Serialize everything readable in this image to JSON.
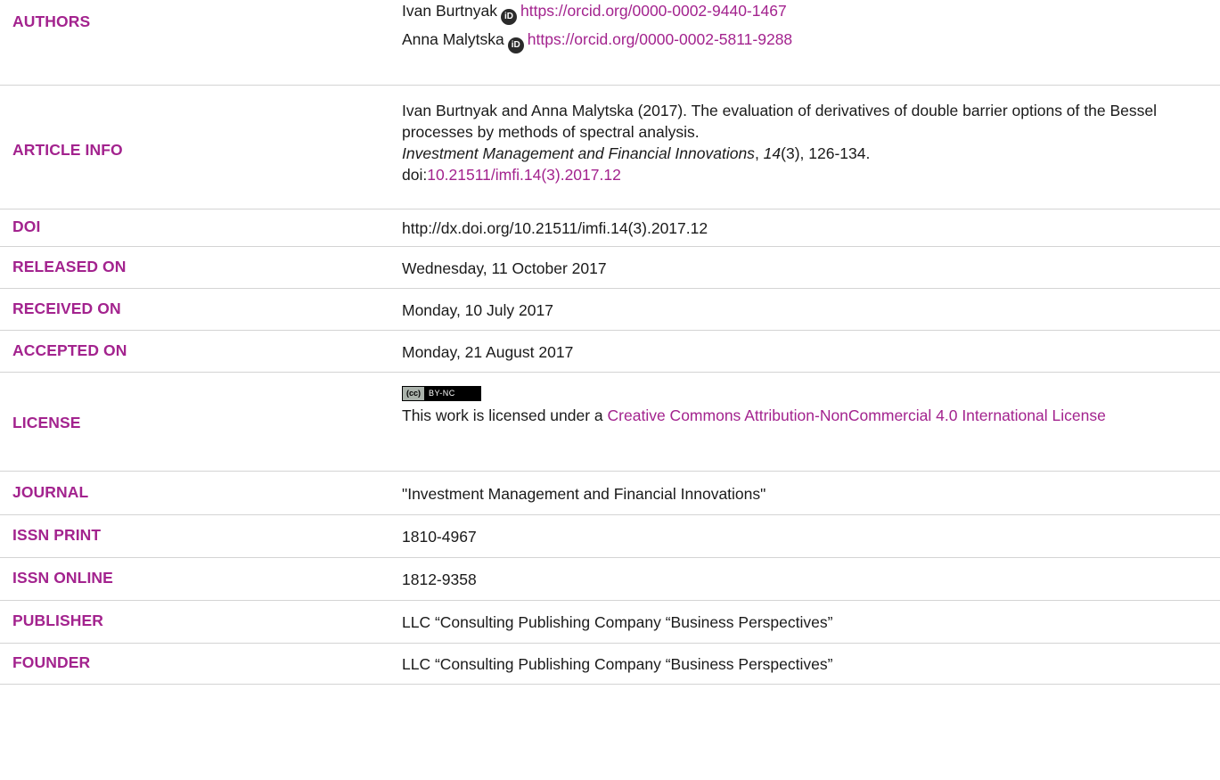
{
  "authors": {
    "label": "AUTHORS",
    "list": [
      {
        "name": "Ivan Burtnyak",
        "orcid_icon": "iD",
        "orcid_url": "https://orcid.org/0000-0002-9440-1467"
      },
      {
        "name": "Anna Malytska",
        "orcid_icon": "iD",
        "orcid_url": "https://orcid.org/0000-0002-5811-9288"
      }
    ]
  },
  "article_info": {
    "label": "ARTICLE INFO",
    "citation_pre": "Ivan Burtnyak and Anna Malytska (2017). The evaluation of derivatives of double barrier options of the Bessel processes by methods of spectral analysis.",
    "journal_italic": "Investment Management and Financial Innovations",
    "sep1": ", ",
    "volume_italic": "14",
    "issue_pages": "(3), 126-134.",
    "doi_prefix": "doi:",
    "doi_link": "10.21511/imfi.14(3).2017.12"
  },
  "doi": {
    "label": "DOI",
    "value": "http://dx.doi.org/10.21511/imfi.14(3).2017.12"
  },
  "released": {
    "label": "RELEASED ON",
    "value": "Wednesday, 11 October 2017"
  },
  "received": {
    "label": "RECEIVED ON",
    "value": "Monday, 10 July 2017"
  },
  "accepted": {
    "label": "ACCEPTED ON",
    "value": "Monday, 21 August 2017"
  },
  "license": {
    "label": "LICENSE",
    "badge_left": "(cc)",
    "badge_right": "BY-NC",
    "text_pre": "This work is licensed under a ",
    "link_text": "Creative Commons Attribution-NonCommercial 4.0 International License"
  },
  "journal": {
    "label": "JOURNAL",
    "value": "\"Investment Management and Financial Innovations\""
  },
  "issn_print": {
    "label": "ISSN PRINT",
    "value": "1810-4967"
  },
  "issn_online": {
    "label": "ISSN ONLINE",
    "value": "1812-9358"
  },
  "publisher": {
    "label": "PUBLISHER",
    "value": "LLC “Consulting Publishing Company “Business Perspectives”"
  },
  "founder": {
    "label": "FOUNDER",
    "value": "LLC “Consulting Publishing Company “Business Perspectives”"
  },
  "colors": {
    "accent": "#a3238e",
    "text": "#1a1a1a",
    "rule": "#d4d4d4"
  }
}
